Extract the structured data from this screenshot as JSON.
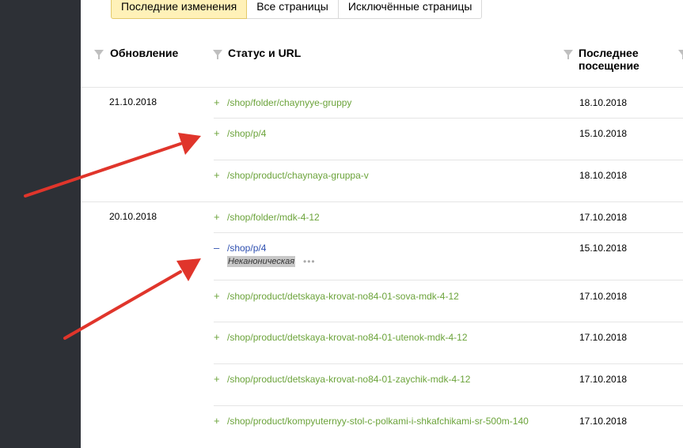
{
  "tabs": [
    "Последние изменения",
    "Все страницы",
    "Исключённые страницы"
  ],
  "columns": {
    "update": "Обновление",
    "status_url": "Статус и URL",
    "last_visit_line1": "Последнее",
    "last_visit_line2": "посещение"
  },
  "groups": [
    {
      "date": "21.10.2018",
      "rows": [
        {
          "sign": "+",
          "url": "/shop/folder/chaynyye-gruppy",
          "visit": "18.10.2018"
        },
        {
          "sign": "+",
          "url": "/shop/p/4",
          "visit": "15.10.2018"
        },
        {
          "sign": "+",
          "url": "/shop/product/chaynaya-gruppa-v",
          "visit": "18.10.2018"
        }
      ]
    },
    {
      "date": "20.10.2018",
      "rows": [
        {
          "sign": "+",
          "url": "/shop/folder/mdk-4-12",
          "visit": "17.10.2018"
        },
        {
          "sign": "–",
          "url": "/shop/p/4",
          "visit": "15.10.2018",
          "badge": "Неканоническая",
          "more": "•••"
        },
        {
          "sign": "+",
          "url": "/shop/product/detskaya-krovat-no84-01-sova-mdk-4-12",
          "visit": "17.10.2018"
        },
        {
          "sign": "+",
          "url": "/shop/product/detskaya-krovat-no84-01-utenok-mdk-4-12",
          "visit": "17.10.2018"
        },
        {
          "sign": "+",
          "url": "/shop/product/detskaya-krovat-no84-01-zaychik-mdk-4-12",
          "visit": "17.10.2018"
        },
        {
          "sign": "+",
          "url": "/shop/product/kompyuternyy-stol-c-polkami-i-shkafchikami-sr-500m-140",
          "visit": "17.10.2018"
        }
      ]
    }
  ],
  "colors": {
    "sidebar": "#2d3036",
    "added": "#6ba33a",
    "removed": "#2e4fb0",
    "active_tab": "#fff1b8",
    "arrow": "#e0352b"
  },
  "icons": [
    "filter-icon",
    "more-icon",
    "arrow-annotation"
  ]
}
